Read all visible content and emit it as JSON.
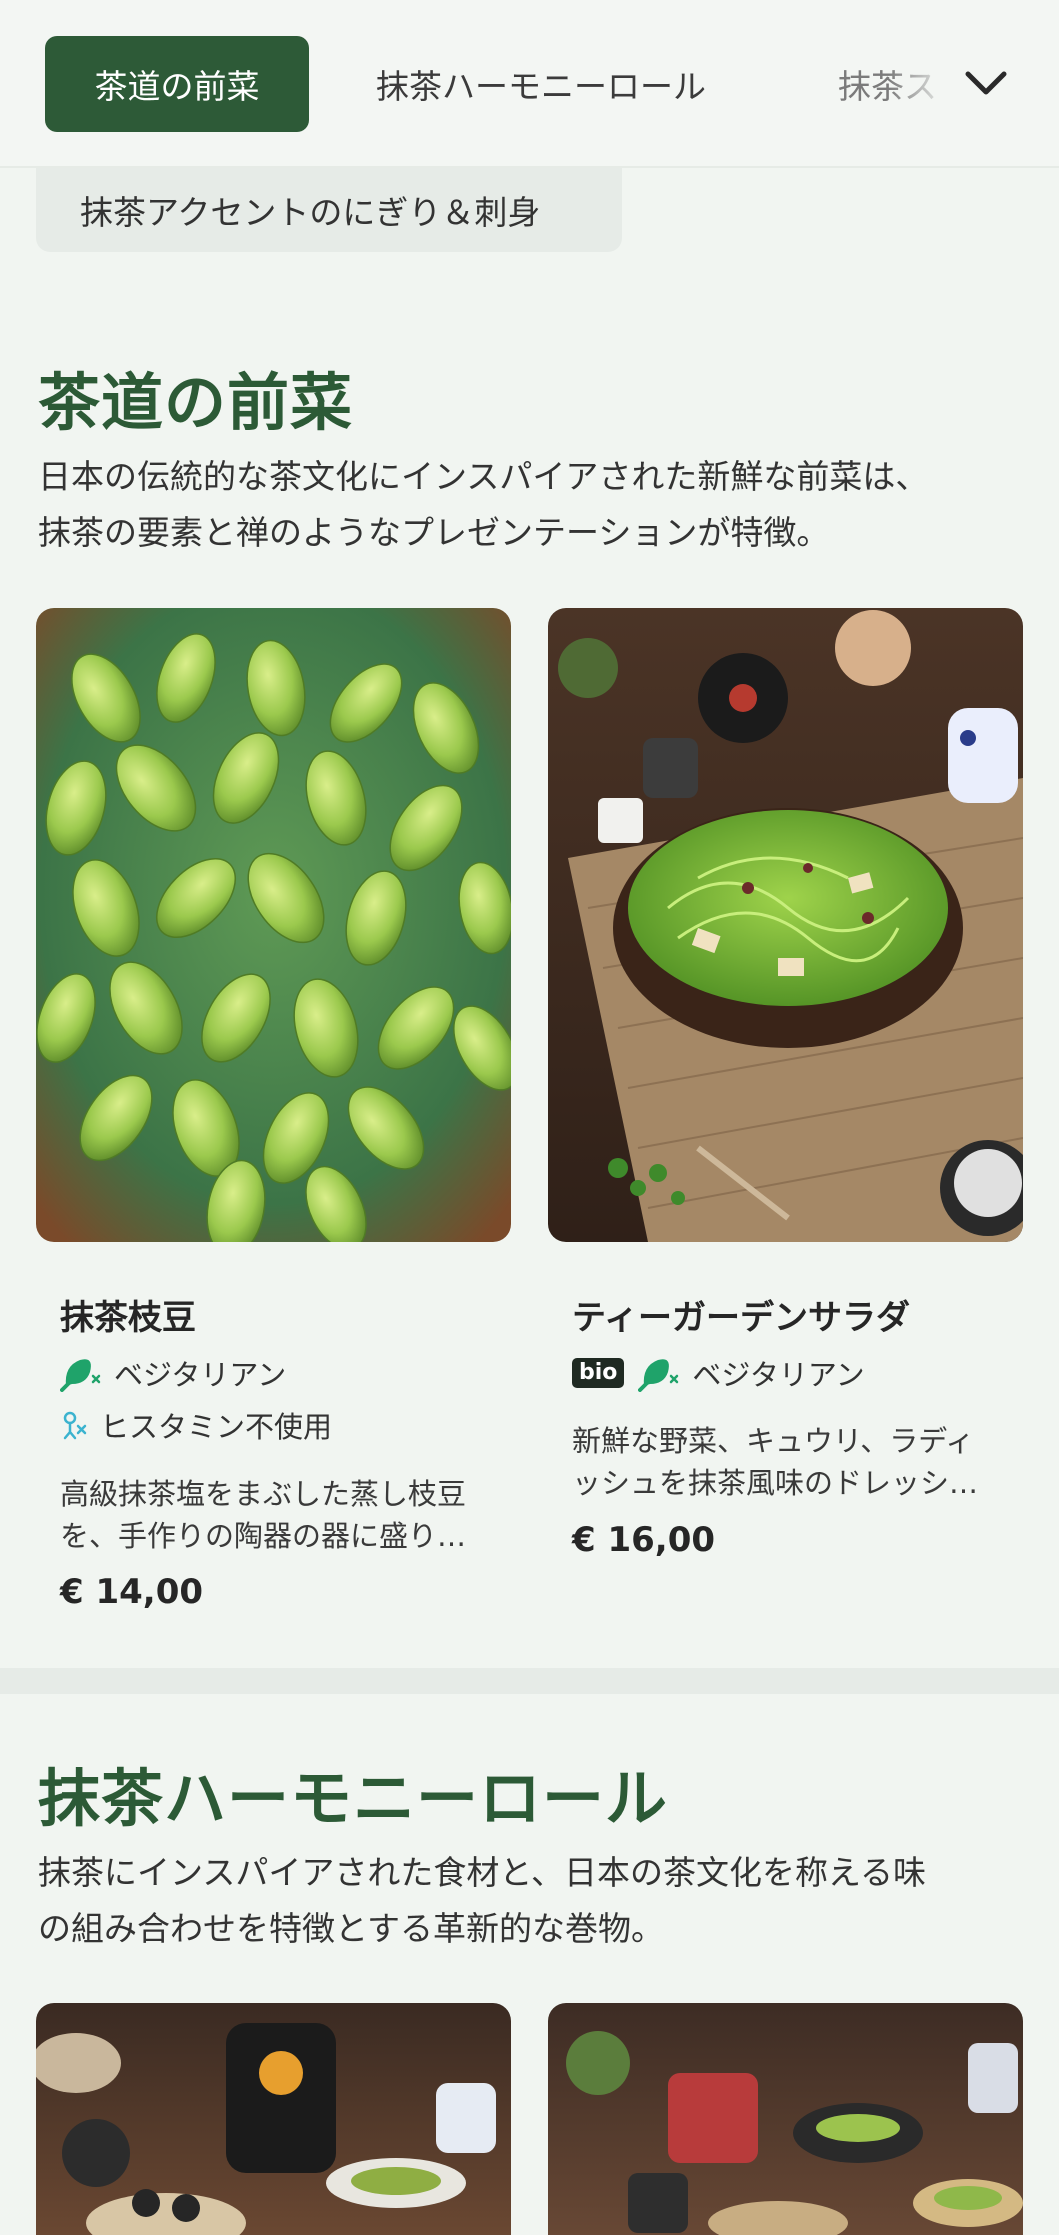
{
  "tabs": [
    {
      "label": "茶道の前菜",
      "active": true
    },
    {
      "label": "抹茶ハーモニーロール",
      "active": false
    },
    {
      "label": "抹茶ス",
      "active": false
    }
  ],
  "chip": {
    "label": "抹茶アクセントのにぎり＆刺身"
  },
  "sections": [
    {
      "title": "茶道の前菜",
      "description_lines": [
        "日本の伝統的な茶文化にインスパイアされた新鮮な前菜は、",
        "抹茶の要素と禅のようなプレゼンテーションが特徴。"
      ],
      "items": [
        {
          "name": "抹茶枝豆",
          "tags": [
            "ベジタリアン",
            "ヒスタミン不使用"
          ],
          "description_lines": [
            "高級抹茶塩をまぶした蒸し枝豆",
            "を、手作りの陶器の器に盛り…"
          ],
          "price": "€ 14,00",
          "image_icon": "edamame-photo"
        },
        {
          "name": "ティーガーデンサラダ",
          "badge": "bio",
          "tags": [
            "ベジタリアン"
          ],
          "description_lines": [
            "新鮮な野菜、キュウリ、ラディ",
            "ッシュを抹茶風味のドレッシ…"
          ],
          "price": "€ 16,00",
          "image_icon": "salad-photo"
        }
      ]
    },
    {
      "title": "抹茶ハーモニーロール",
      "description_lines": [
        "抹茶にインスパイアされた食材と、日本の茶文化を称える味",
        "の組み合わせを特徴とする革新的な巻物。"
      ]
    }
  ],
  "icons": {
    "expand": "chevron-down-icon",
    "vegetarian": "leaf-drumstick-icon",
    "histamine": "histamine-free-icon"
  },
  "colors": {
    "accent": "#2d5a37",
    "vegetarian_icon": "#1fa36a",
    "histamine_icon": "#3bb3cf",
    "background": "#f1f5f1"
  }
}
